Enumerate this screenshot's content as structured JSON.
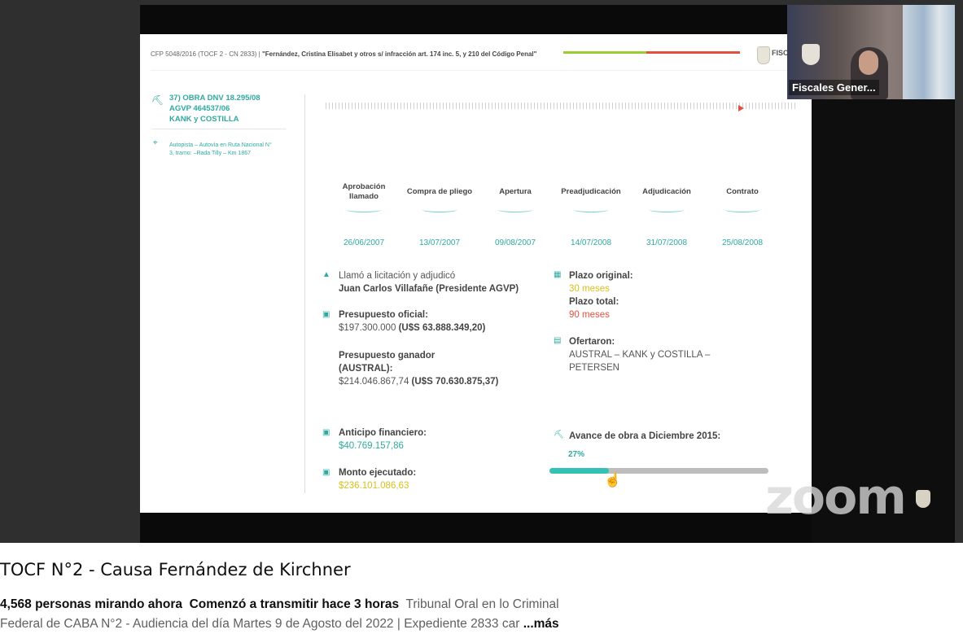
{
  "webcam": {
    "name": "Fiscales Gener..."
  },
  "watermark": "zoom",
  "slide": {
    "header_prefix": "CFP 5048/2016 (TOCF 2 - CN 2833) |",
    "header_title": "\"Fernández, Cristina Elisabet y otros s/ infracción art. 174 inc. 5, y 210 del Código Penal\"",
    "logo_text": "FISC",
    "obra": [
      "37) OBRA DNV 18.295/08",
      "AGVP 464537/06",
      "KANK y COSTILLA"
    ],
    "location": "Autopista – Autovía en Ruta Nacional N° 3, tramo: –Rada Tilly – Km 1867",
    "timeline": {
      "progress_colors": {
        "green": "#9acd32",
        "red": "#e5503d"
      },
      "events": [
        {
          "label": "Aprobación llamado",
          "date": "26/06/2007"
        },
        {
          "label": "Compra de pliego",
          "date": "13/07/2007"
        },
        {
          "label": "Apertura",
          "date": "09/08/2007"
        },
        {
          "label": "Preadjudicación",
          "date": "14/07/2008"
        },
        {
          "label": "Adjudicación",
          "date": "31/07/2008"
        },
        {
          "label": "Contrato",
          "date": "25/08/2008"
        }
      ]
    },
    "licitacion": {
      "title": "Llamó a licitación y adjudicó",
      "value": "Juan Carlos Villafañe (Presidente AGVP)"
    },
    "presupuesto_oficial": {
      "title": "Presupuesto oficial:",
      "value": "$197.300.000",
      "usd": "(U$S 63.888.349,20)"
    },
    "presupuesto_ganador": {
      "title_1": "Presupuesto ganador",
      "title_2": "(AUSTRAL):",
      "value": "$214.046.867,74",
      "usd": "(U$S 70.630.875,37)"
    },
    "plazo": {
      "original_label": "Plazo original:",
      "original_value": "30 meses",
      "total_label": "Plazo total:",
      "total_value": "90 meses"
    },
    "ofertaron": {
      "title": "Ofertaron:",
      "value_1": "AUSTRAL – KANK y COSTILLA –",
      "value_2": "PETERSEN"
    },
    "anticipo": {
      "title": "Anticipo financiero:",
      "value": "$40.769.157,86"
    },
    "monto": {
      "title": "Monto ejecutado:",
      "value": "$236.101.086,63"
    },
    "avance": {
      "title": "Avance de obra a Diciembre 2015:",
      "percent_text": "27%",
      "percent": 27
    }
  },
  "video": {
    "title": "TOCF N°2 - Causa Fernández de Kirchner",
    "viewers": "4,568 personas mirando ahora",
    "started": "Comenzó a transmitir hace 3 horas",
    "description_1": "Tribunal Oral en lo Criminal",
    "description_2": "Federal de CABA N°2 - Audiencia del día Martes 9 de Agosto del 2022 | Expediente 2833 car",
    "more": "...más"
  }
}
